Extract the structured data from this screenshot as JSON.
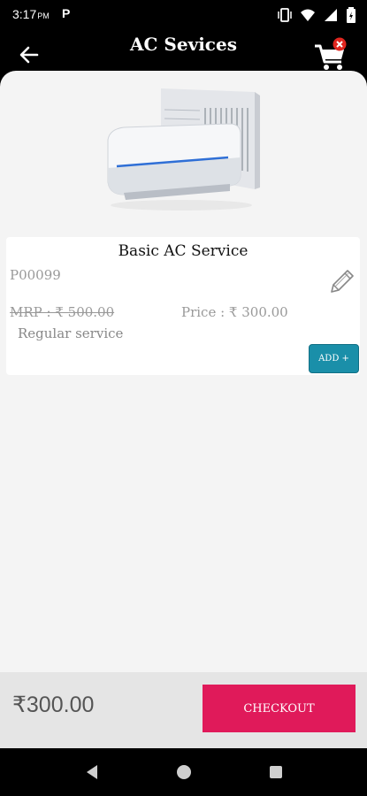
{
  "status_bar": {
    "time": "3:17",
    "ampm": "PM",
    "app_indicator": "P"
  },
  "app_bar": {
    "title": "AC Sevices"
  },
  "service": {
    "name": "Basic AC Service",
    "code": "P00099",
    "mrp": "MRP : ₹ 500.00",
    "price": "Price : ₹ 300.00",
    "type": "Regular service",
    "add_label": "ADD +"
  },
  "footer": {
    "total": "₹300.00",
    "checkout_label": "CHECKOUT"
  },
  "colors": {
    "checkout": "#e01a5a",
    "add_button": "#1a8fa9",
    "cart_badge": "#e0261f"
  }
}
